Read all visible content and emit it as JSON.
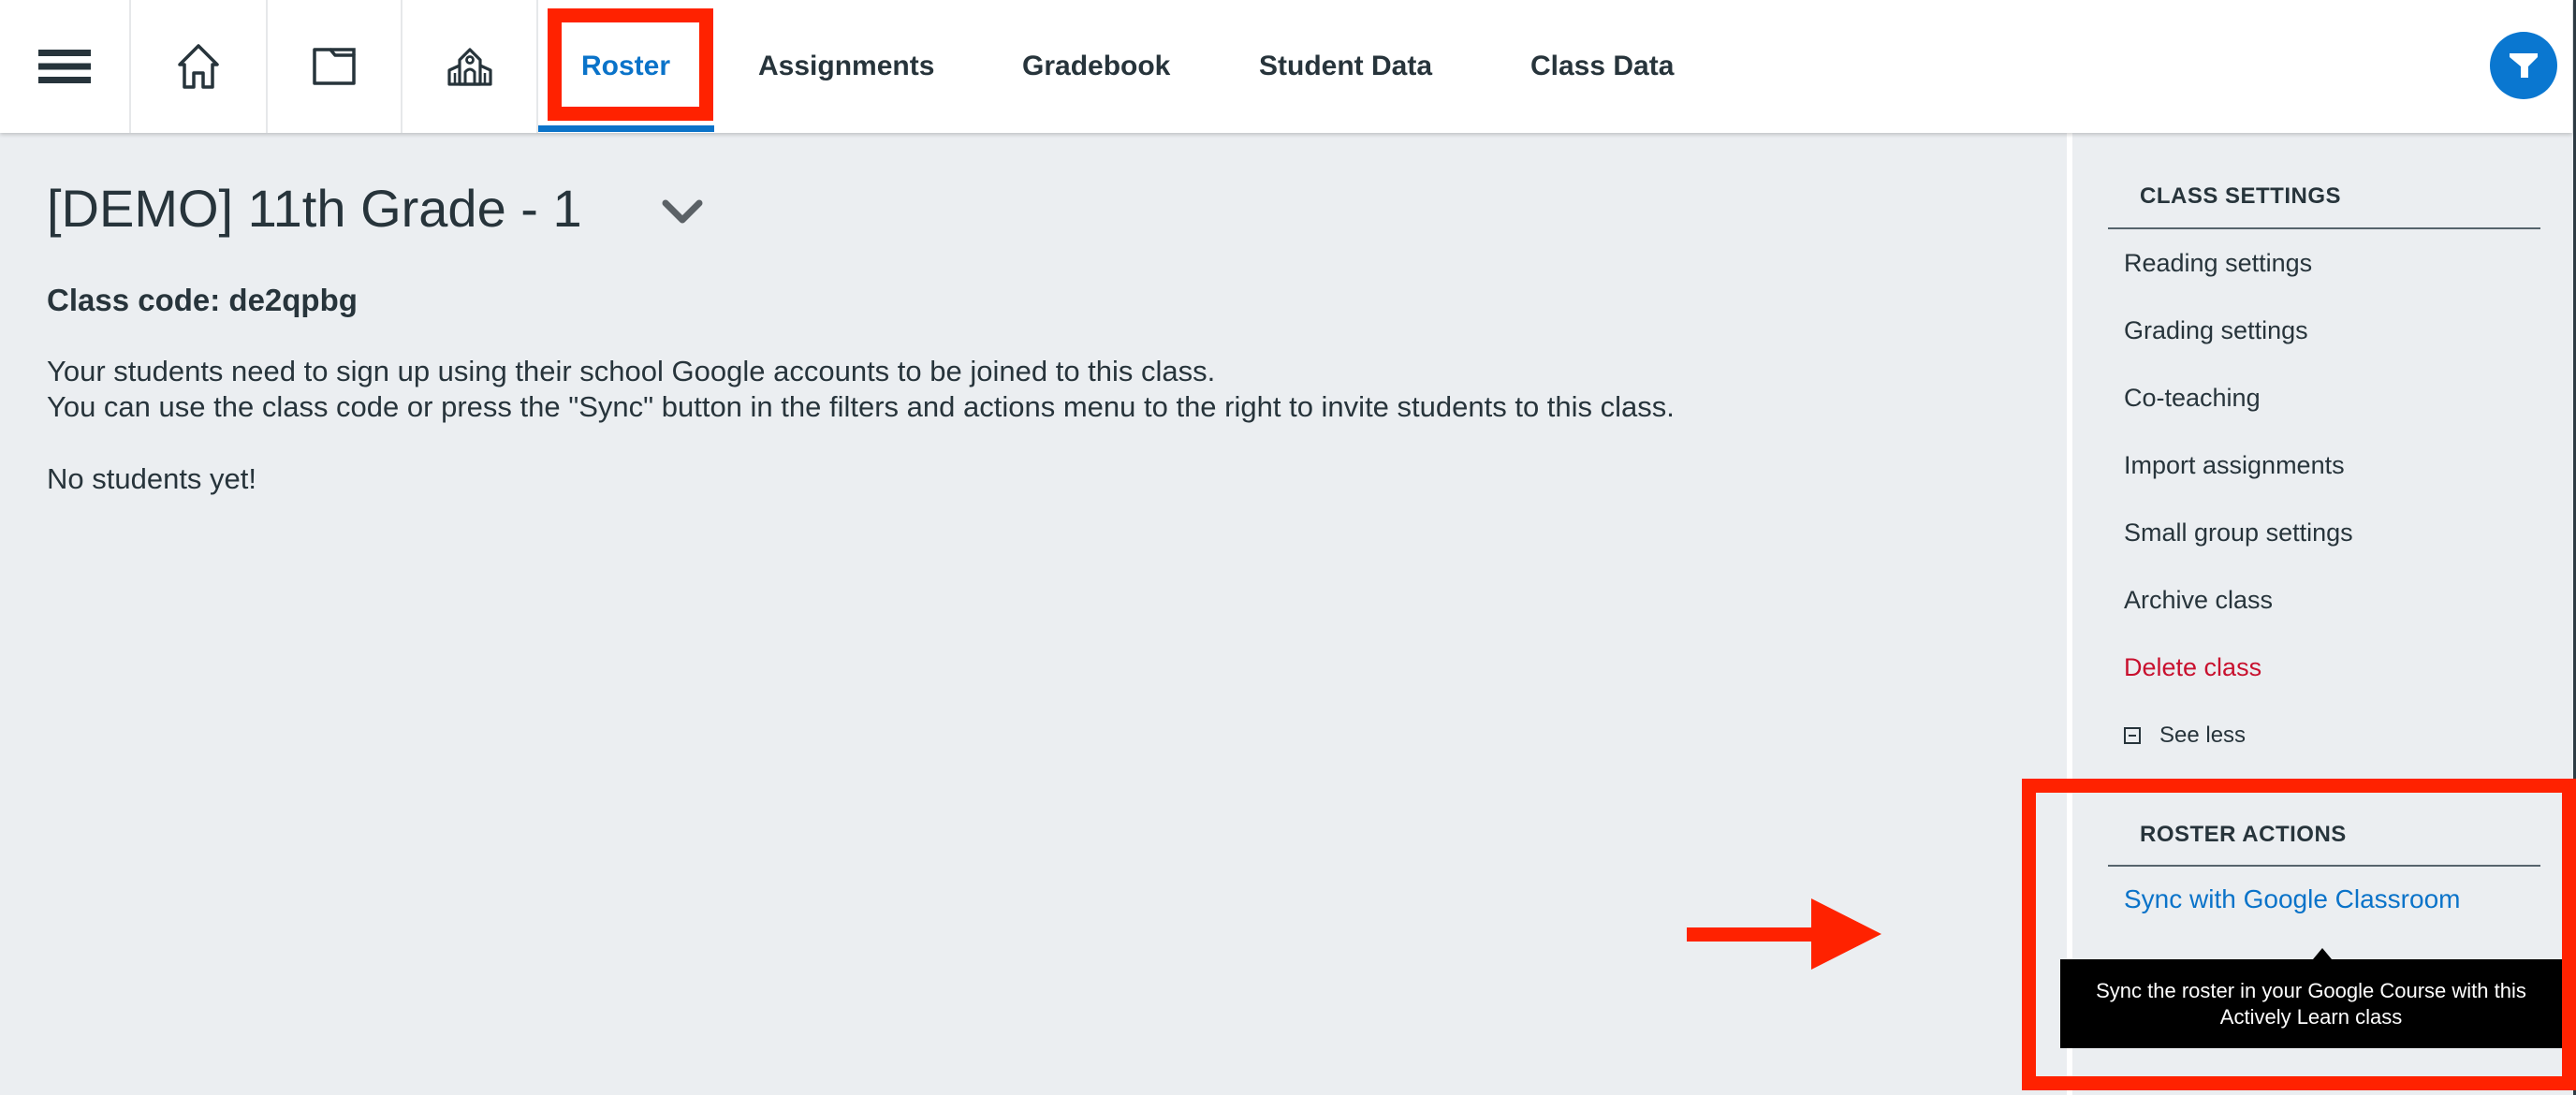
{
  "header": {
    "icons": [
      {
        "name": "menu-icon",
        "label": "Menu"
      },
      {
        "name": "home-icon",
        "label": "Home"
      },
      {
        "name": "folder-icon",
        "label": "Library"
      },
      {
        "name": "school-icon",
        "label": "Classes"
      }
    ],
    "tabs": [
      {
        "label": "Roster",
        "active": true
      },
      {
        "label": "Assignments",
        "active": false
      },
      {
        "label": "Gradebook",
        "active": false
      },
      {
        "label": "Student Data",
        "active": false
      },
      {
        "label": "Class Data",
        "active": false
      }
    ],
    "filter_button": {
      "icon": "filter-icon"
    },
    "accent_color": "#0a73c9"
  },
  "main": {
    "class_title": "[DEMO] 11th Grade - 1",
    "class_code_label": "Class code: de2qpbg",
    "description_lines": [
      "Your students need to sign up using their school Google accounts to be joined to this class.",
      "You can use the class code or press the \"Sync\" button in the filters and actions menu to the right to invite students to this class."
    ],
    "empty_message": "No students yet!"
  },
  "sidebar": {
    "class_settings": {
      "heading": "CLASS SETTINGS",
      "items": [
        {
          "label": "Reading settings"
        },
        {
          "label": "Grading settings"
        },
        {
          "label": "Co-teaching"
        },
        {
          "label": "Import assignments"
        },
        {
          "label": "Small group settings"
        },
        {
          "label": "Archive class"
        },
        {
          "label": "Delete class",
          "danger": true
        }
      ],
      "see_less": "See less"
    },
    "roster_actions": {
      "heading": "ROSTER ACTIONS",
      "items": [
        {
          "label": "Sync with Google Classroom"
        }
      ],
      "tooltip": "Sync the roster in your Google Course with this Actively Learn class"
    },
    "danger_color": "#c8102e"
  },
  "annotations": {
    "highlight_color": "#ff2200",
    "highlights": [
      "Roster tab",
      "Roster actions section"
    ],
    "arrow": "pointing-right"
  }
}
